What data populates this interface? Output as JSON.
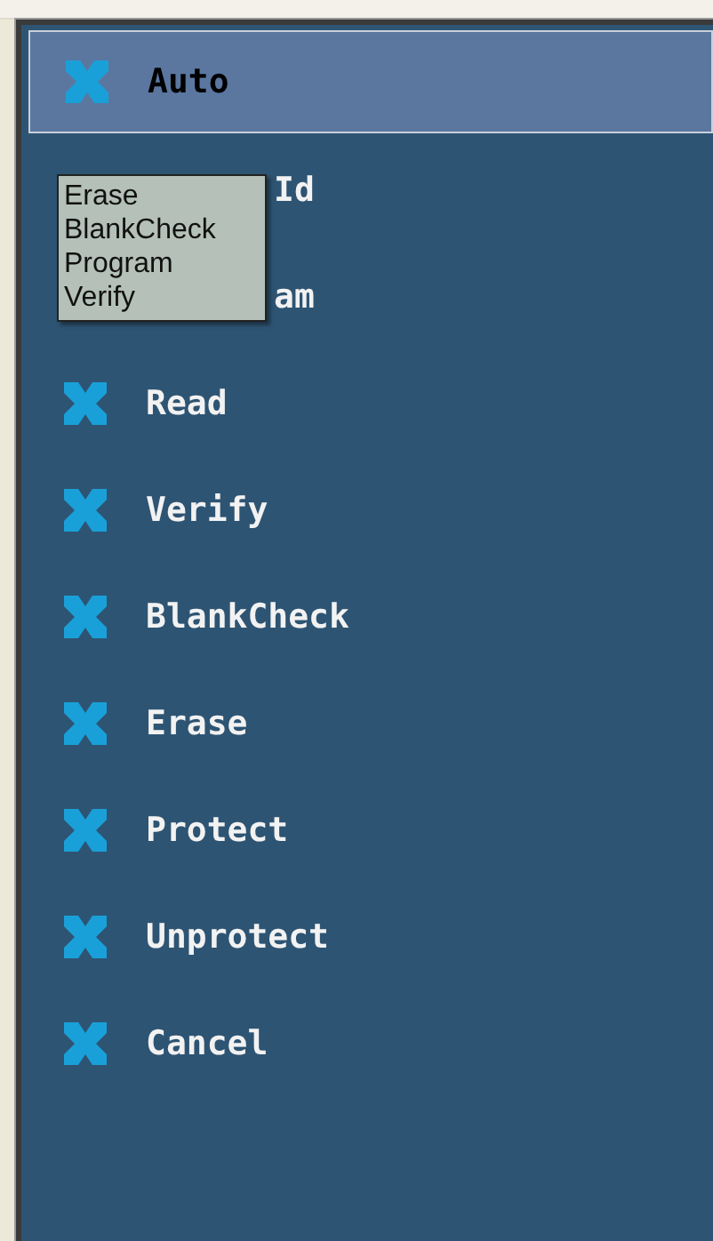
{
  "menu": {
    "items": [
      {
        "label": "Auto",
        "selected": true,
        "kind": "plain"
      },
      {
        "label": "Id",
        "selected": false,
        "kind": "covered"
      },
      {
        "label": "am",
        "selected": false,
        "kind": "covered"
      },
      {
        "label": "Read",
        "selected": false,
        "kind": "plain"
      },
      {
        "label": "Verify",
        "selected": false,
        "kind": "plain"
      },
      {
        "label": "BlankCheck",
        "selected": false,
        "kind": "plain"
      },
      {
        "label": "Erase",
        "selected": false,
        "kind": "plain"
      },
      {
        "label": "Protect",
        "selected": false,
        "kind": "plain"
      },
      {
        "label": "Unprotect",
        "selected": false,
        "kind": "plain"
      },
      {
        "label": "Cancel",
        "selected": false,
        "kind": "plain"
      }
    ]
  },
  "tooltip": {
    "lines": [
      "Erase",
      "BlankCheck",
      "Program",
      "Verify"
    ]
  }
}
